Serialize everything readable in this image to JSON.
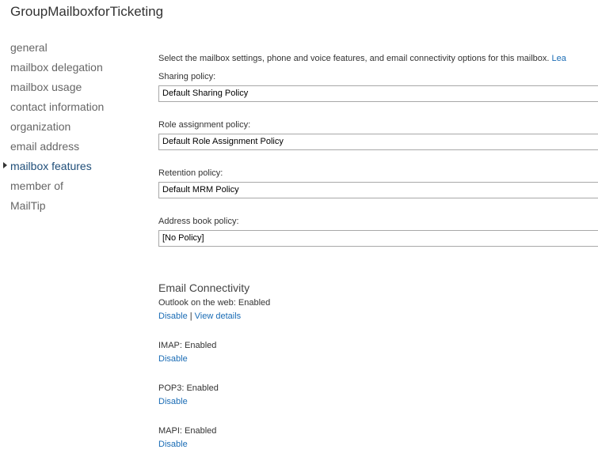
{
  "window": {
    "title": "GroupMailboxforTicketing"
  },
  "nav": {
    "items": [
      {
        "label": "general"
      },
      {
        "label": "mailbox delegation"
      },
      {
        "label": "mailbox usage"
      },
      {
        "label": "contact information"
      },
      {
        "label": "organization"
      },
      {
        "label": "email address"
      },
      {
        "label": "mailbox features"
      },
      {
        "label": "member of"
      },
      {
        "label": "MailTip"
      }
    ],
    "active": "mailbox features"
  },
  "main": {
    "intro_text": "Select the mailbox settings, phone and voice features, and email connectivity options for this mailbox.",
    "intro_link": "Lea",
    "sharing": {
      "label": "Sharing policy:",
      "value": "Default Sharing Policy"
    },
    "role": {
      "label": "Role assignment policy:",
      "value": "Default Role Assignment Policy"
    },
    "retention": {
      "label": "Retention policy:",
      "value": "Default MRM Policy"
    },
    "addressbook": {
      "label": "Address book policy:",
      "value": "[No Policy]"
    },
    "connectivity": {
      "title": "Email Connectivity",
      "owa": {
        "status": "Outlook on the web: Enabled",
        "disable": "Disable",
        "separator": "|",
        "details": "View details"
      },
      "imap": {
        "status": "IMAP: Enabled",
        "disable": "Disable"
      },
      "pop3": {
        "status": "POP3: Enabled",
        "disable": "Disable"
      },
      "mapi": {
        "status": "MAPI: Enabled",
        "disable": "Disable"
      }
    }
  },
  "colors": {
    "link": "#1a6cb5",
    "active_nav": "#1f4e79",
    "text": "#333333"
  }
}
